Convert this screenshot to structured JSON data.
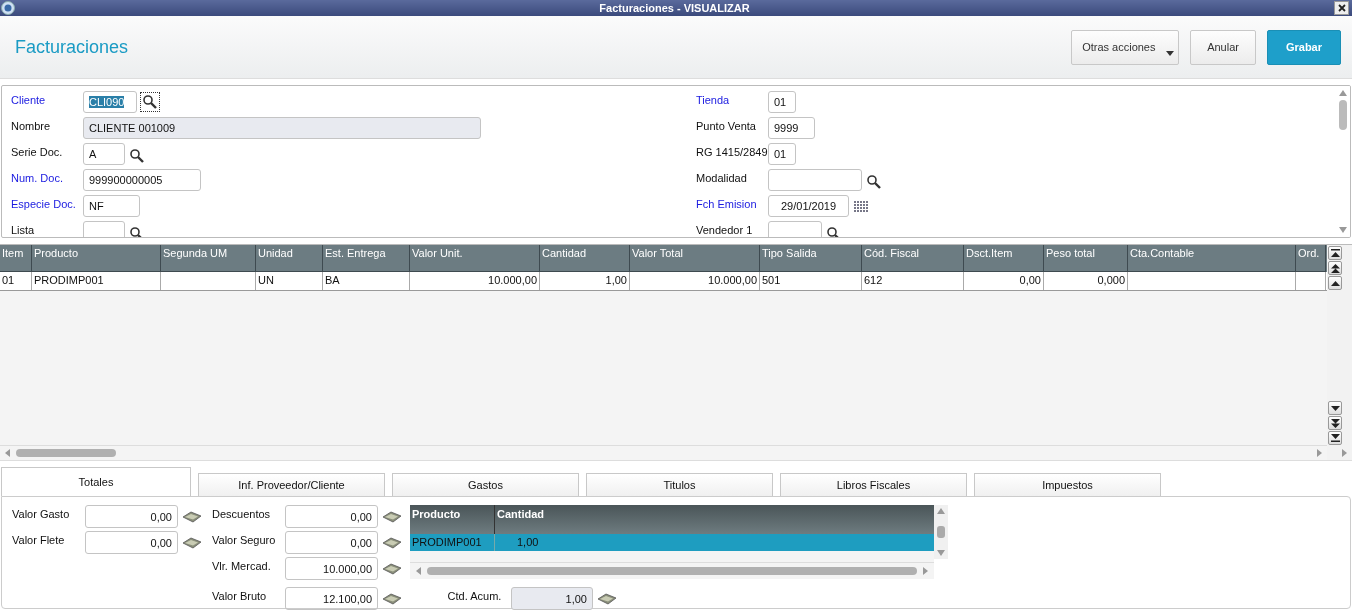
{
  "window": {
    "title": "Facturaciones - VISUALIZAR"
  },
  "header": {
    "title": "Facturaciones",
    "buttons": [
      {
        "label": "Otras acciones",
        "kind": "menu"
      },
      {
        "label": "Anular",
        "kind": "plain"
      },
      {
        "label": "Grabar",
        "kind": "primary"
      }
    ]
  },
  "form": {
    "left": [
      {
        "label": "Cliente",
        "value": "CLI090",
        "required": true,
        "kind": "lookup",
        "text_selected": true
      },
      {
        "label": "Nombre",
        "value": "CLIENTE 001009",
        "required": false,
        "kind": "readonly",
        "text_selected": false
      },
      {
        "label": "Serie Doc.",
        "value": "A",
        "required": false,
        "kind": "lookup",
        "text_selected": false
      },
      {
        "label": "Num. Doc.",
        "value": "999900000005",
        "required": true,
        "kind": "text",
        "text_selected": false
      },
      {
        "label": "Especie Doc.",
        "value": "NF",
        "required": true,
        "kind": "text",
        "text_selected": false
      },
      {
        "label": "Lista",
        "required": false,
        "kind": "lookup"
      }
    ],
    "right": [
      {
        "label": "Tienda",
        "value": "01",
        "required": true,
        "kind": "text",
        "text_selected": false
      },
      {
        "label": "Punto Venta",
        "value": "9999",
        "required": false,
        "kind": "text",
        "text_selected": false
      },
      {
        "label": "RG 1415/2849",
        "value": "01",
        "required": false,
        "kind": "text",
        "text_selected": false
      },
      {
        "label": "Modalidad",
        "required": false,
        "kind": "lookup"
      },
      {
        "label": "Fch Emision",
        "value": "29/01/2019",
        "required": true,
        "kind": "date",
        "text_selected": false
      },
      {
        "label": "Vendedor 1",
        "required": false,
        "kind": "lookup"
      }
    ]
  },
  "table": {
    "columns": [
      "Item",
      "Producto",
      "Segunda UM",
      "Unidad",
      "Est. Entrega",
      "Valor Unit.",
      "Cantidad",
      "Valor Total",
      "Tipo Salida",
      "Cód. Fiscal",
      "Dsct.Item",
      "Peso total",
      "Cta.Contable",
      "Ord."
    ],
    "rows": [
      {
        "cells": [
          "01",
          "PRODIMP001",
          null,
          "UN",
          "BA",
          "10.000,00",
          "1,00",
          "10.000,00",
          "501",
          "612",
          "0,00",
          "0,000",
          null,
          null
        ]
      }
    ]
  },
  "tabs": [
    {
      "label": "Totales",
      "selected": true
    },
    {
      "label": "Inf. Proveedor/Cliente",
      "selected": false
    },
    {
      "label": "Gastos",
      "selected": false
    },
    {
      "label": "Titulos",
      "selected": false
    },
    {
      "label": "Libros Fiscales",
      "selected": false
    },
    {
      "label": "Impuestos",
      "selected": false
    }
  ],
  "totals": {
    "column_1": [
      {
        "label": "Valor Gasto",
        "value": "0,00",
        "readonly": false
      },
      {
        "label": "Valor Flete",
        "value": "0,00",
        "readonly": false
      }
    ],
    "column_2": [
      {
        "label": "Descuentos",
        "value": "0,00",
        "readonly": false
      },
      {
        "label": "Valor Seguro",
        "value": "0,00",
        "readonly": false
      },
      {
        "label": "Vlr. Mercad.",
        "value": "10.000,00",
        "readonly": false
      }
    ],
    "grid": {
      "columns": [
        "Producto",
        "Cantidad"
      ],
      "rows": [
        {
          "cells": [
            "PRODIMP001",
            "1,00"
          ],
          "selected": true
        }
      ]
    },
    "bottom": [
      {
        "label": "Valor Bruto",
        "value": "12.100,00",
        "readonly": false
      },
      {
        "label": "Ctd. Acum.",
        "value": "1,00",
        "readonly": true
      }
    ]
  }
}
